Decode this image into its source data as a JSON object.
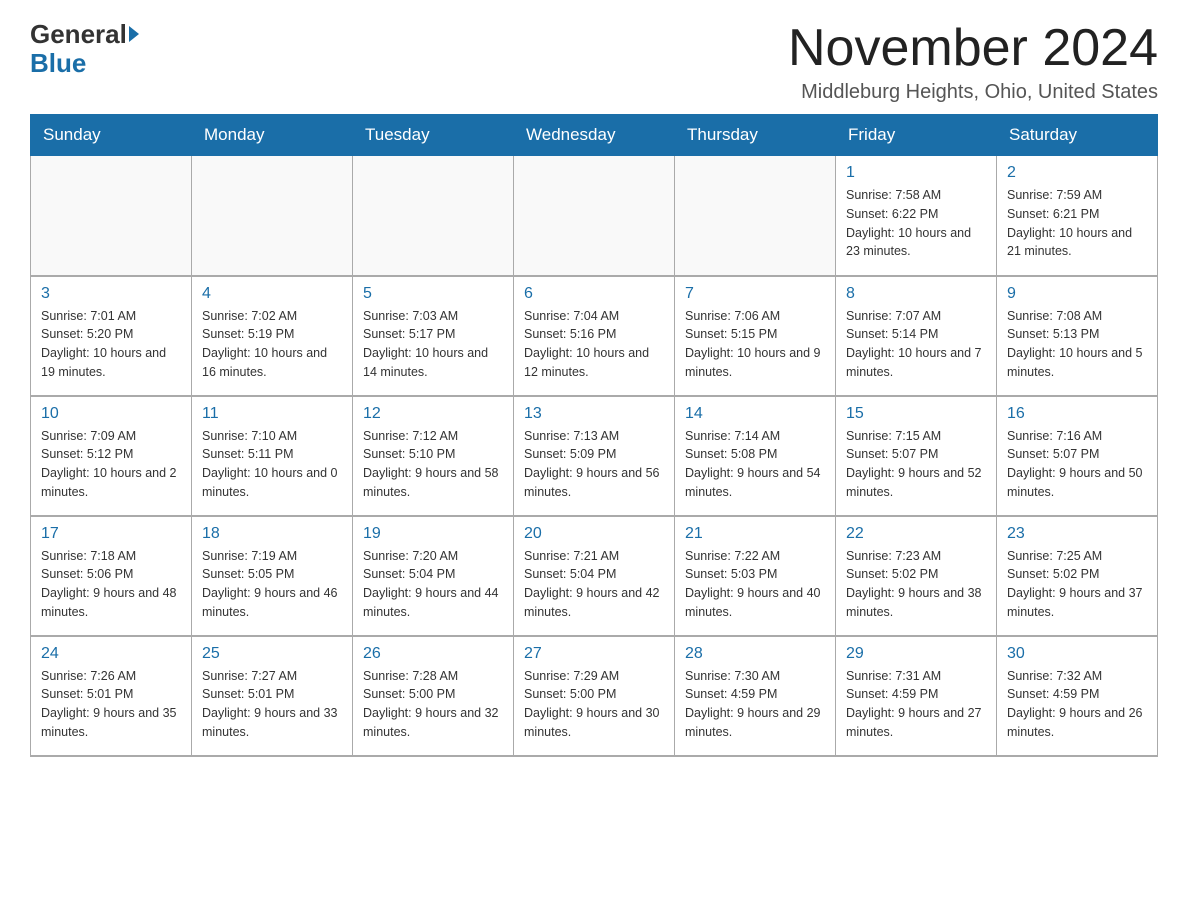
{
  "header": {
    "logo_general": "General",
    "logo_blue": "Blue",
    "title": "November 2024",
    "subtitle": "Middleburg Heights, Ohio, United States"
  },
  "days_of_week": [
    "Sunday",
    "Monday",
    "Tuesday",
    "Wednesday",
    "Thursday",
    "Friday",
    "Saturday"
  ],
  "weeks": [
    [
      {
        "day": "",
        "info": ""
      },
      {
        "day": "",
        "info": ""
      },
      {
        "day": "",
        "info": ""
      },
      {
        "day": "",
        "info": ""
      },
      {
        "day": "",
        "info": ""
      },
      {
        "day": "1",
        "info": "Sunrise: 7:58 AM\nSunset: 6:22 PM\nDaylight: 10 hours and 23 minutes."
      },
      {
        "day": "2",
        "info": "Sunrise: 7:59 AM\nSunset: 6:21 PM\nDaylight: 10 hours and 21 minutes."
      }
    ],
    [
      {
        "day": "3",
        "info": "Sunrise: 7:01 AM\nSunset: 5:20 PM\nDaylight: 10 hours and 19 minutes."
      },
      {
        "day": "4",
        "info": "Sunrise: 7:02 AM\nSunset: 5:19 PM\nDaylight: 10 hours and 16 minutes."
      },
      {
        "day": "5",
        "info": "Sunrise: 7:03 AM\nSunset: 5:17 PM\nDaylight: 10 hours and 14 minutes."
      },
      {
        "day": "6",
        "info": "Sunrise: 7:04 AM\nSunset: 5:16 PM\nDaylight: 10 hours and 12 minutes."
      },
      {
        "day": "7",
        "info": "Sunrise: 7:06 AM\nSunset: 5:15 PM\nDaylight: 10 hours and 9 minutes."
      },
      {
        "day": "8",
        "info": "Sunrise: 7:07 AM\nSunset: 5:14 PM\nDaylight: 10 hours and 7 minutes."
      },
      {
        "day": "9",
        "info": "Sunrise: 7:08 AM\nSunset: 5:13 PM\nDaylight: 10 hours and 5 minutes."
      }
    ],
    [
      {
        "day": "10",
        "info": "Sunrise: 7:09 AM\nSunset: 5:12 PM\nDaylight: 10 hours and 2 minutes."
      },
      {
        "day": "11",
        "info": "Sunrise: 7:10 AM\nSunset: 5:11 PM\nDaylight: 10 hours and 0 minutes."
      },
      {
        "day": "12",
        "info": "Sunrise: 7:12 AM\nSunset: 5:10 PM\nDaylight: 9 hours and 58 minutes."
      },
      {
        "day": "13",
        "info": "Sunrise: 7:13 AM\nSunset: 5:09 PM\nDaylight: 9 hours and 56 minutes."
      },
      {
        "day": "14",
        "info": "Sunrise: 7:14 AM\nSunset: 5:08 PM\nDaylight: 9 hours and 54 minutes."
      },
      {
        "day": "15",
        "info": "Sunrise: 7:15 AM\nSunset: 5:07 PM\nDaylight: 9 hours and 52 minutes."
      },
      {
        "day": "16",
        "info": "Sunrise: 7:16 AM\nSunset: 5:07 PM\nDaylight: 9 hours and 50 minutes."
      }
    ],
    [
      {
        "day": "17",
        "info": "Sunrise: 7:18 AM\nSunset: 5:06 PM\nDaylight: 9 hours and 48 minutes."
      },
      {
        "day": "18",
        "info": "Sunrise: 7:19 AM\nSunset: 5:05 PM\nDaylight: 9 hours and 46 minutes."
      },
      {
        "day": "19",
        "info": "Sunrise: 7:20 AM\nSunset: 5:04 PM\nDaylight: 9 hours and 44 minutes."
      },
      {
        "day": "20",
        "info": "Sunrise: 7:21 AM\nSunset: 5:04 PM\nDaylight: 9 hours and 42 minutes."
      },
      {
        "day": "21",
        "info": "Sunrise: 7:22 AM\nSunset: 5:03 PM\nDaylight: 9 hours and 40 minutes."
      },
      {
        "day": "22",
        "info": "Sunrise: 7:23 AM\nSunset: 5:02 PM\nDaylight: 9 hours and 38 minutes."
      },
      {
        "day": "23",
        "info": "Sunrise: 7:25 AM\nSunset: 5:02 PM\nDaylight: 9 hours and 37 minutes."
      }
    ],
    [
      {
        "day": "24",
        "info": "Sunrise: 7:26 AM\nSunset: 5:01 PM\nDaylight: 9 hours and 35 minutes."
      },
      {
        "day": "25",
        "info": "Sunrise: 7:27 AM\nSunset: 5:01 PM\nDaylight: 9 hours and 33 minutes."
      },
      {
        "day": "26",
        "info": "Sunrise: 7:28 AM\nSunset: 5:00 PM\nDaylight: 9 hours and 32 minutes."
      },
      {
        "day": "27",
        "info": "Sunrise: 7:29 AM\nSunset: 5:00 PM\nDaylight: 9 hours and 30 minutes."
      },
      {
        "day": "28",
        "info": "Sunrise: 7:30 AM\nSunset: 4:59 PM\nDaylight: 9 hours and 29 minutes."
      },
      {
        "day": "29",
        "info": "Sunrise: 7:31 AM\nSunset: 4:59 PM\nDaylight: 9 hours and 27 minutes."
      },
      {
        "day": "30",
        "info": "Sunrise: 7:32 AM\nSunset: 4:59 PM\nDaylight: 9 hours and 26 minutes."
      }
    ]
  ]
}
